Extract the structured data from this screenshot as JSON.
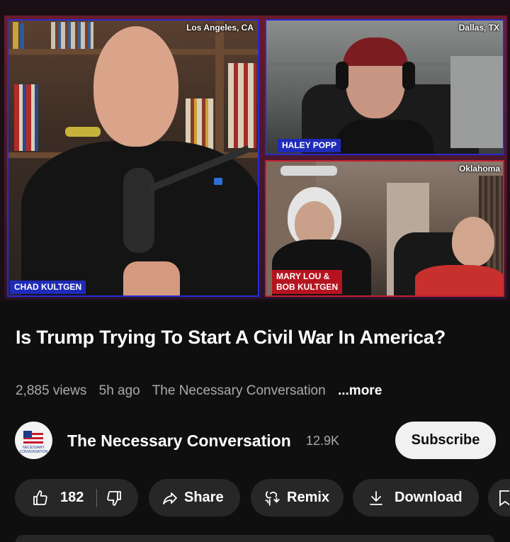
{
  "video": {
    "tiles": {
      "main": {
        "location": "Los Angeles, CA",
        "name": "CHAD KULTGEN"
      },
      "top_right": {
        "location": "Dallas, TX",
        "name": "HALEY POPP"
      },
      "bottom_right": {
        "location": "Oklahoma",
        "name_line1": "MARY LOU &",
        "name_line2": "BOB KULTGEN"
      }
    },
    "accent_blue": "#1f2bb8",
    "accent_red": "#b5141f"
  },
  "title": "Is Trump Trying To Start A Civil War In America?",
  "meta": {
    "views": "2,885 views",
    "age": "5h ago",
    "channel": "The Necessary Conversation",
    "more": "...more"
  },
  "channel": {
    "name": "The Necessary Conversation",
    "subscribers": "12.9K",
    "subscribe_label": "Subscribe",
    "avatar_text": "NECESSARY CONVERSATION"
  },
  "actions": {
    "likes": "182",
    "share": "Share",
    "remix": "Remix",
    "download": "Download"
  },
  "icons": [
    "thumbs-up-icon",
    "thumbs-down-icon",
    "share-arrow-icon",
    "remix-icon",
    "download-icon",
    "bookmark-icon"
  ]
}
